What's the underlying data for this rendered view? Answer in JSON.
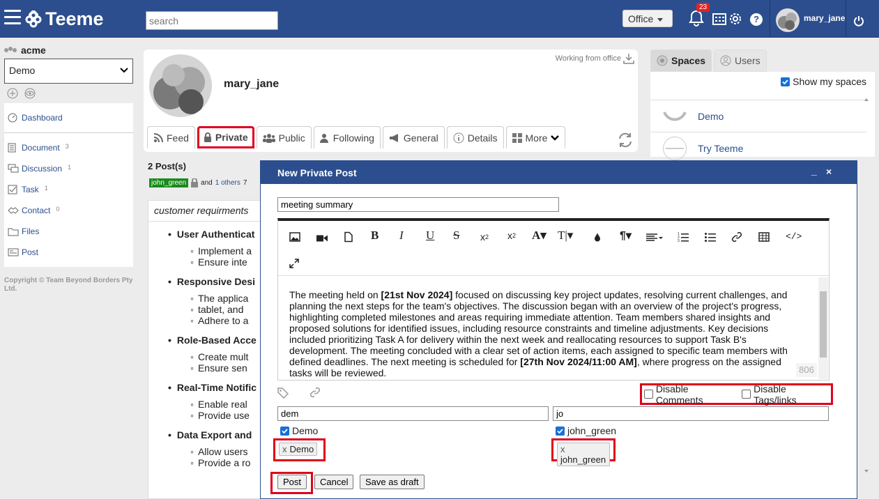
{
  "header": {
    "app_name": "Teeme",
    "search_placeholder": "search",
    "workspace_label": "Office",
    "notification_count": "23",
    "username": "mary_jane"
  },
  "sidebar": {
    "org_name": "acme",
    "space_selected": "Demo",
    "items": [
      {
        "label": "Dashboard",
        "count": ""
      },
      {
        "label": "Document",
        "count": "3"
      },
      {
        "label": "Discussion",
        "count": "1"
      },
      {
        "label": "Task",
        "count": "1"
      },
      {
        "label": "Contact",
        "count": "0"
      },
      {
        "label": "Files",
        "count": ""
      },
      {
        "label": "Post",
        "count": ""
      }
    ],
    "copyright": "Copyright © Team Beyond Borders Pty Ltd."
  },
  "profile": {
    "name": "mary_jane",
    "status": "Working from office",
    "tabs": [
      "Feed",
      "Private",
      "Public",
      "Following",
      "General",
      "Details",
      "More"
    ],
    "active_tab": "Private"
  },
  "posts": {
    "count_label": "2 Post(s)",
    "author_tag": "john_green",
    "and_text": "and",
    "others_link": "1 others",
    "others_suffix": "7",
    "title": "customer requirments",
    "items": [
      {
        "heading": "User Authenticat",
        "subs": [
          "Implement a",
          "Ensure inte"
        ]
      },
      {
        "heading": "Responsive Desi",
        "subs": [
          "The applica",
          "tablet, and ",
          "Adhere to a"
        ]
      },
      {
        "heading": "Role-Based Acce",
        "subs": [
          "Create mult",
          "Ensure sen"
        ]
      },
      {
        "heading": "Real-Time Notific",
        "subs": [
          "Enable real",
          "Provide use"
        ]
      },
      {
        "heading": "Data Export and",
        "subs": [
          "Allow users",
          "Provide a ro"
        ]
      }
    ]
  },
  "right_panel": {
    "tabs": [
      "Spaces",
      "Users"
    ],
    "show_my_spaces": "Show my spaces",
    "spaces": [
      "Demo",
      "Try Teeme"
    ]
  },
  "modal": {
    "title": "New Private Post",
    "minimize": "_",
    "close": "×",
    "subject": "meeting summary",
    "body_1": "The meeting held on ",
    "body_2": "[21st Nov 2024]",
    "body_3": " focused on discussing key project updates, resolving current challenges, and planning the next steps for the team's objectives. The discussion began with an overview of the project's progress, highlighting completed milestones and areas requiring immediate attention. Team members shared insights and proposed solutions for identified issues, including resource constraints and timeline adjustments. Key decisions included prioritizing Task A for delivery within the next week and reallocating resources to support Task B's development. The meeting concluded with a clear set of action items, each assigned to specific team members with defined deadlines. The next meeting is scheduled for ",
    "body_4": "[27th Nov 2024/11:00 AM]",
    "body_5": ", where progress on the assigned tasks will be reviewed.",
    "word_count": "806",
    "disable_comments": "Disable Comments",
    "disable_tags": "Disable Tags/links",
    "space_search": "dem",
    "user_search": "jo",
    "space_option": "Demo",
    "user_option": "john_green",
    "space_chip": "Demo",
    "user_chip": "john_green",
    "chip_remove": "x",
    "buttons": {
      "post": "Post",
      "cancel": "Cancel",
      "draft": "Save as draft"
    }
  }
}
